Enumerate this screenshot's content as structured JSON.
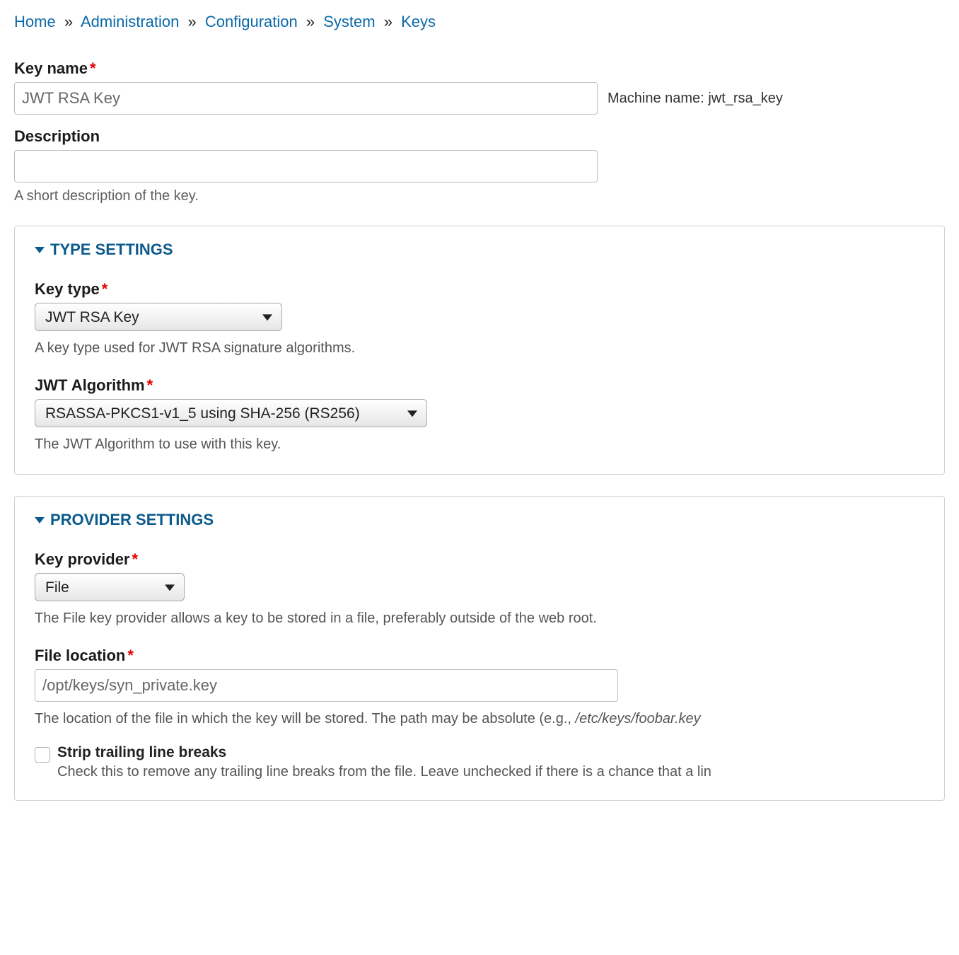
{
  "breadcrumb": {
    "items": [
      {
        "label": "Home"
      },
      {
        "label": "Administration"
      },
      {
        "label": "Configuration"
      },
      {
        "label": "System"
      },
      {
        "label": "Keys"
      }
    ],
    "separator": "»"
  },
  "key_name": {
    "label": "Key name",
    "value": "JWT RSA Key",
    "machine_name_label": "Machine name:",
    "machine_name_value": "jwt_rsa_key"
  },
  "description": {
    "label": "Description",
    "value": "",
    "help": "A short description of the key."
  },
  "type_settings": {
    "legend": "Type Settings",
    "key_type": {
      "label": "Key type",
      "value": "JWT RSA Key",
      "help": "A key type used for JWT RSA signature algorithms."
    },
    "jwt_algorithm": {
      "label": "JWT Algorithm",
      "value": "RSASSA-PKCS1-v1_5 using SHA-256 (RS256)",
      "help": "The JWT Algorithm to use with this key."
    }
  },
  "provider_settings": {
    "legend": "Provider Settings",
    "key_provider": {
      "label": "Key provider",
      "value": "File",
      "help": "The File key provider allows a key to be stored in a file, preferably outside of the web root."
    },
    "file_location": {
      "label": "File location",
      "value": "/opt/keys/syn_private.key",
      "help_prefix": "The location of the file in which the key will be stored. The path may be absolute (e.g., ",
      "help_path_example": "/etc/keys/foobar.key"
    },
    "strip_trailing": {
      "label": "Strip trailing line breaks",
      "help": "Check this to remove any trailing line breaks from the file. Leave unchecked if there is a chance that a lin",
      "checked": false
    }
  }
}
